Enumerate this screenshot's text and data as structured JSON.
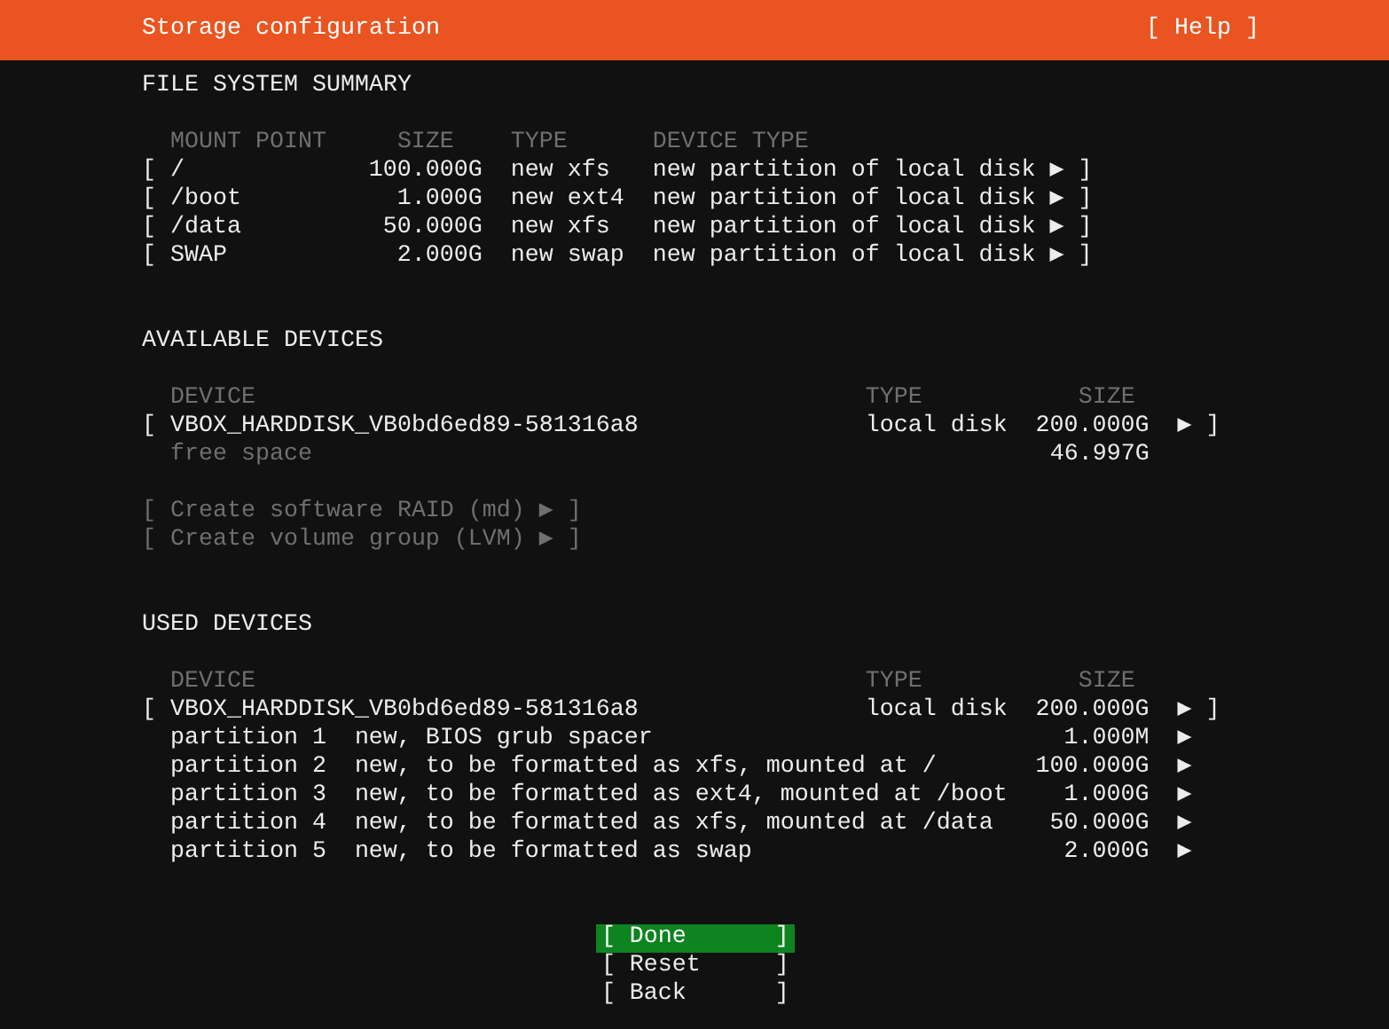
{
  "header": {
    "title": "Storage configuration",
    "help": "[ Help ]"
  },
  "file_system_summary": {
    "heading": "FILE SYSTEM SUMMARY",
    "columns": [
      "MOUNT POINT",
      "SIZE",
      "TYPE",
      "DEVICE TYPE"
    ],
    "rows": [
      {
        "open": "[",
        "mount_point": "/",
        "size": "100.000G",
        "type": "new xfs",
        "device_type": "new partition of local disk",
        "arrow": "▶",
        "close": "]"
      },
      {
        "open": "[",
        "mount_point": "/boot",
        "size": "1.000G",
        "type": "new ext4",
        "device_type": "new partition of local disk",
        "arrow": "▶",
        "close": "]"
      },
      {
        "open": "[",
        "mount_point": "/data",
        "size": "50.000G",
        "type": "new xfs",
        "device_type": "new partition of local disk",
        "arrow": "▶",
        "close": "]"
      },
      {
        "open": "[",
        "mount_point": "SWAP",
        "size": "2.000G",
        "type": "new swap",
        "device_type": "new partition of local disk",
        "arrow": "▶",
        "close": "]"
      }
    ]
  },
  "available_devices": {
    "heading": "AVAILABLE DEVICES",
    "columns": [
      "DEVICE",
      "TYPE",
      "SIZE"
    ],
    "disks": [
      {
        "open": "[",
        "name": "VBOX_HARDDISK_VB0bd6ed89-581316a8",
        "type": "local disk",
        "size": "200.000G",
        "arrow": "▶",
        "close": "]",
        "free_space": {
          "label": "free space",
          "size": "46.997G"
        }
      }
    ],
    "actions": [
      {
        "open": "[",
        "label": "Create software RAID (md)",
        "arrow": "▶",
        "close": "]",
        "disabled": true
      },
      {
        "open": "[",
        "label": "Create volume group (LVM)",
        "arrow": "▶",
        "close": "]",
        "disabled": true
      }
    ]
  },
  "used_devices": {
    "heading": "USED DEVICES",
    "columns": [
      "DEVICE",
      "TYPE",
      "SIZE"
    ],
    "disks": [
      {
        "open": "[",
        "name": "VBOX_HARDDISK_VB0bd6ed89-581316a8",
        "type": "local disk",
        "size": "200.000G",
        "arrow": "▶",
        "close": "]",
        "partitions": [
          {
            "name": "partition 1",
            "description": "new, BIOS grub spacer",
            "size": "1.000M",
            "arrow": "▶"
          },
          {
            "name": "partition 2",
            "description": "new, to be formatted as xfs, mounted at /",
            "size": "100.000G",
            "arrow": "▶"
          },
          {
            "name": "partition 3",
            "description": "new, to be formatted as ext4, mounted at /boot",
            "size": "1.000G",
            "arrow": "▶"
          },
          {
            "name": "partition 4",
            "description": "new, to be formatted as xfs, mounted at /data",
            "size": "50.000G",
            "arrow": "▶"
          },
          {
            "name": "partition 5",
            "description": "new, to be formatted as swap",
            "size": "2.000G",
            "arrow": "▶"
          }
        ]
      }
    ]
  },
  "buttons": [
    {
      "open": "[",
      "label": "Done",
      "close": "]",
      "selected": true
    },
    {
      "open": "[",
      "label": "Reset",
      "close": "]",
      "selected": false
    },
    {
      "open": "[",
      "label": "Back",
      "close": "]",
      "selected": false
    }
  ]
}
